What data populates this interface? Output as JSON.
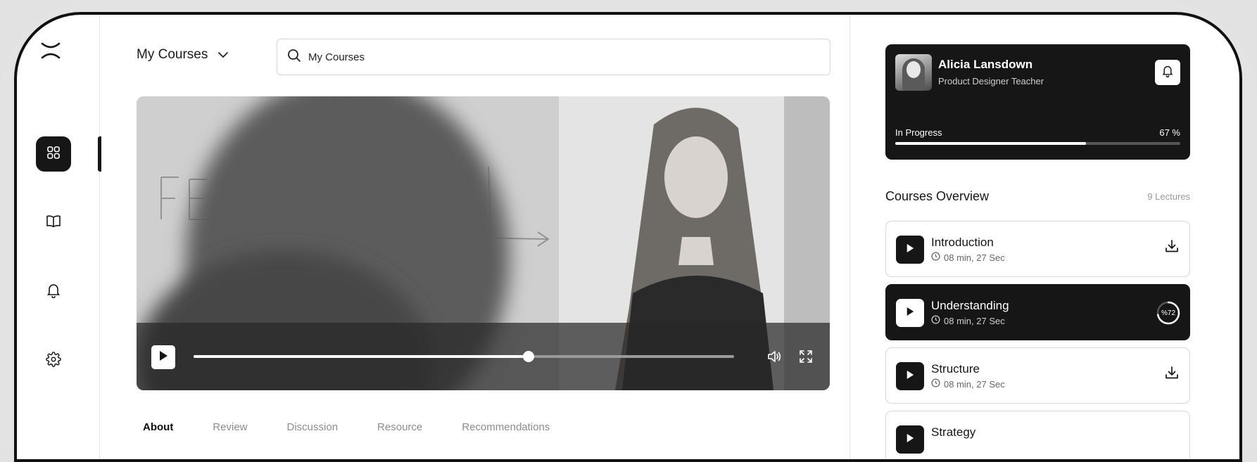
{
  "header": {
    "title": "My Courses"
  },
  "search": {
    "value": "My Courses"
  },
  "video": {
    "progress_percent": 62
  },
  "tabs": [
    {
      "label": "About",
      "active": true
    },
    {
      "label": "Review",
      "active": false
    },
    {
      "label": "Discussion",
      "active": false
    },
    {
      "label": "Resource",
      "active": false
    },
    {
      "label": "Recommendations",
      "active": false
    }
  ],
  "profile": {
    "name": "Alicia Lansdown",
    "role": "Product Designer Teacher",
    "progress_label": "In Progress",
    "progress_text": "67 %",
    "progress_percent": 67
  },
  "overview": {
    "title": "Courses Overview",
    "count": "9 Lectures",
    "items": [
      {
        "title": "Introduction",
        "duration": "08 min, 27 Sec",
        "state": "download"
      },
      {
        "title": "Understanding",
        "duration": "08 min, 27 Sec",
        "state": "active",
        "percent_text": "%72",
        "percent": 72
      },
      {
        "title": "Structure",
        "duration": "08 min, 27 Sec",
        "state": "download"
      },
      {
        "title": "Strategy",
        "duration": "",
        "state": "download"
      }
    ]
  }
}
